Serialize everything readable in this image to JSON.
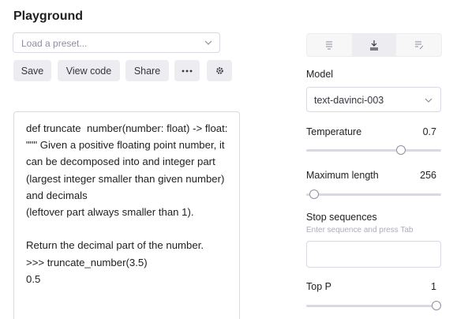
{
  "header": {
    "title": "Playground"
  },
  "preset": {
    "placeholder": "Load a preset..."
  },
  "toolbar": {
    "save_label": "Save",
    "view_code_label": "View code",
    "share_label": "Share",
    "more_label": "···"
  },
  "editor": {
    "text": "def truncate  number(number: float) -> float:\n\"\"\" Given a positive floating point number, it can be decomposed into and integer part (largest integer smaller than given number) and decimals\n(leftover part always smaller than 1).\n\nReturn the decimal part of the number.\n>>> truncate_number(3.5)\n0.5"
  },
  "settings": {
    "mode_icons": [
      "complete-icon",
      "insert-icon",
      "edit-icon"
    ],
    "active_mode": 1,
    "model": {
      "label": "Model",
      "value": "text-davinci-003"
    },
    "temperature": {
      "label": "Temperature",
      "value": "0.7",
      "fraction": 0.7
    },
    "max_length": {
      "label": "Maximum length",
      "value": "256",
      "fraction": 0.06
    },
    "stop_sequences": {
      "label": "Stop sequences",
      "hint": "Enter sequence and press Tab"
    },
    "top_p": {
      "label": "Top P",
      "value": "1",
      "fraction": 1.0
    }
  }
}
